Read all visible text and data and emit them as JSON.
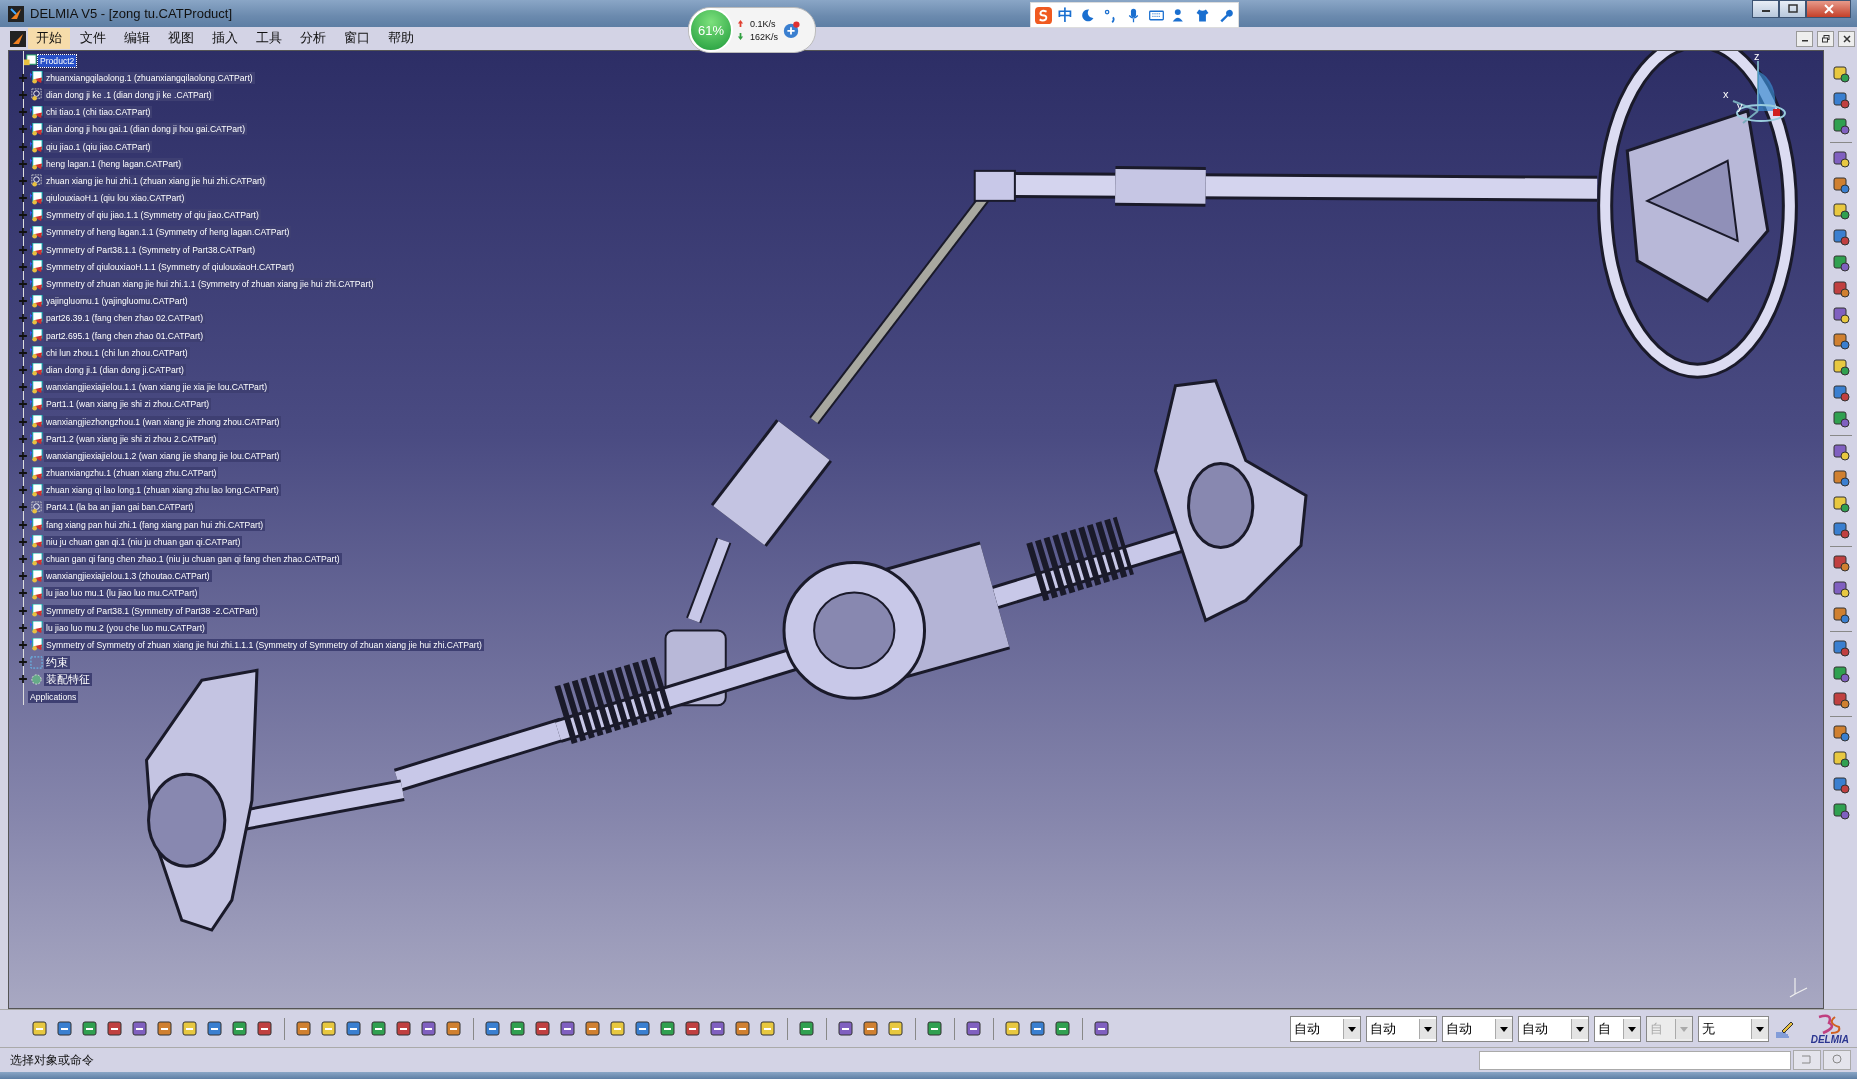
{
  "window": {
    "title": "DELMIA V5 - [zong tu.CATProduct]"
  },
  "menu": [
    {
      "label": "开始",
      "selected": true
    },
    {
      "label": "文件",
      "selected": false
    },
    {
      "label": "编辑",
      "selected": false
    },
    {
      "label": "视图",
      "selected": false
    },
    {
      "label": "插入",
      "selected": false
    },
    {
      "label": "工具",
      "selected": false
    },
    {
      "label": "分析",
      "selected": false
    },
    {
      "label": "窗口",
      "selected": false
    },
    {
      "label": "帮助",
      "selected": false
    }
  ],
  "net_monitor": {
    "percent": "61%",
    "upload": "0.1K/s",
    "download": "162K/s"
  },
  "ime_bar": {
    "mode": "中"
  },
  "tree": {
    "root": {
      "label": "Product2",
      "selected": true
    },
    "items": [
      {
        "label": "zhuanxiangqilaolong.1 (zhuanxiangqilaolong.CATPart)",
        "kind": "part",
        "selected": false
      },
      {
        "label": "dian dong ji ke .1 (dian dong ji ke .CATPart)",
        "kind": "unloaded",
        "selected": false
      },
      {
        "label": "chi tiao.1 (chi tiao.CATPart)",
        "kind": "part",
        "selected": false
      },
      {
        "label": "dian dong ji hou gai.1 (dian dong ji hou gai.CATPart)",
        "kind": "part",
        "selected": false
      },
      {
        "label": "qiu jiao.1 (qiu jiao.CATPart)",
        "kind": "part",
        "selected": false
      },
      {
        "label": "heng lagan.1 (heng lagan.CATPart)",
        "kind": "part",
        "selected": false
      },
      {
        "label": "zhuan xiang jie hui zhi.1 (zhuan xiang jie hui zhi.CATPart)",
        "kind": "unloaded",
        "selected": false
      },
      {
        "label": "qiulouxiaoH.1 (qiu lou xiao.CATPart)",
        "kind": "part",
        "selected": false
      },
      {
        "label": "Symmetry of qiu jiao.1.1 (Symmetry of qiu jiao.CATPart)",
        "kind": "part",
        "selected": false
      },
      {
        "label": "Symmetry of heng lagan.1.1 (Symmetry of heng lagan.CATPart)",
        "kind": "part",
        "selected": false
      },
      {
        "label": "Symmetry of Part38.1.1 (Symmetry of Part38.CATPart)",
        "kind": "part",
        "selected": false
      },
      {
        "label": "Symmetry of qiulouxiaoH.1.1 (Symmetry of qiulouxiaoH.CATPart)",
        "kind": "part",
        "selected": false
      },
      {
        "label": "Symmetry of zhuan xiang jie hui zhi.1.1 (Symmetry of zhuan xiang jie hui zhi.CATPart)",
        "kind": "part",
        "selected": false
      },
      {
        "label": "yajingluomu.1 (yajingluomu.CATPart)",
        "kind": "part",
        "selected": false
      },
      {
        "label": "part26.39.1 (fang chen zhao 02.CATPart)",
        "kind": "part",
        "selected": false
      },
      {
        "label": "part2.695.1 (fang chen zhao 01.CATPart)",
        "kind": "part",
        "selected": false
      },
      {
        "label": "chi lun zhou.1 (chi lun zhou.CATPart)",
        "kind": "part",
        "selected": false
      },
      {
        "label": "dian dong ji.1 (dian dong ji.CATPart)",
        "kind": "part",
        "selected": false
      },
      {
        "label": "wanxiangjiexiajielou.1.1 (wan xiang jie xia jie lou.CATPart)",
        "kind": "part",
        "selected": false
      },
      {
        "label": "Part1.1 (wan xiang jie shi zi zhou.CATPart)",
        "kind": "part",
        "selected": false
      },
      {
        "label": "wanxiangjiezhongzhou.1 (wan xiang jie zhong zhou.CATPart)",
        "kind": "part",
        "selected": false
      },
      {
        "label": "Part1.2 (wan xiang jie shi zi zhou 2.CATPart)",
        "kind": "part",
        "selected": false
      },
      {
        "label": "wanxiangjiexiajielou.1.2 (wan xiang jie shang jie lou.CATPart)",
        "kind": "part",
        "selected": false
      },
      {
        "label": "zhuanxiangzhu.1 (zhuan xiang zhu.CATPart)",
        "kind": "part",
        "selected": false
      },
      {
        "label": "zhuan xiang qi lao long.1 (zhuan xiang zhu lao long.CATPart)",
        "kind": "part",
        "selected": false
      },
      {
        "label": "Part4.1 (la ba an jian gai ban.CATPart)",
        "kind": "unloaded",
        "selected": false
      },
      {
        "label": "fang xiang pan hui zhi.1 (fang xiang pan hui zhi.CATPart)",
        "kind": "part",
        "selected": false
      },
      {
        "label": "niu ju chuan gan qi.1 (niu ju chuan gan qi.CATPart)",
        "kind": "part",
        "selected": false
      },
      {
        "label": "chuan gan qi fang chen zhao.1 (niu ju chuan gan qi fang chen zhao.CATPart)",
        "kind": "part",
        "selected": false
      },
      {
        "label": "wanxiangjiexiajielou.1.3 (zhoutao.CATPart)",
        "kind": "part",
        "selected": false
      },
      {
        "label": "lu jiao luo mu.1 (lu jiao luo mu.CATPart)",
        "kind": "part",
        "selected": false
      },
      {
        "label": "Symmetry of Part38.1 (Symmetry of Part38 -2.CATPart)",
        "kind": "part",
        "selected": false
      },
      {
        "label": "lu jiao luo mu.2 (you che luo mu.CATPart)",
        "kind": "part",
        "selected": false
      },
      {
        "label": "Symmetry of Symmetry of zhuan xiang jie hui zhi.1.1.1 (Symmetry of Symmetry of zhuan xiang jie hui zhi.CATPart)",
        "kind": "part",
        "selected": false
      },
      {
        "label": "约束",
        "kind": "constraints",
        "selected": false
      },
      {
        "label": "装配特征",
        "kind": "features",
        "selected": false
      }
    ],
    "applications": "Applications"
  },
  "compass": {
    "x": "x",
    "y": "y",
    "z": "z"
  },
  "combos": [
    {
      "value": "自动",
      "kind": "wide",
      "disabled": false
    },
    {
      "value": "自动",
      "kind": "wide",
      "disabled": false
    },
    {
      "value": "自动",
      "kind": "wide",
      "disabled": false
    },
    {
      "value": "自动",
      "kind": "wide",
      "disabled": false
    },
    {
      "value": "自",
      "kind": "narrow",
      "disabled": false
    },
    {
      "value": "自",
      "kind": "narrow",
      "disabled": true
    },
    {
      "value": "无",
      "kind": "wide",
      "disabled": false
    }
  ],
  "logo": "DELMIA",
  "status_bar": {
    "prompt": "选择对象或命令"
  }
}
